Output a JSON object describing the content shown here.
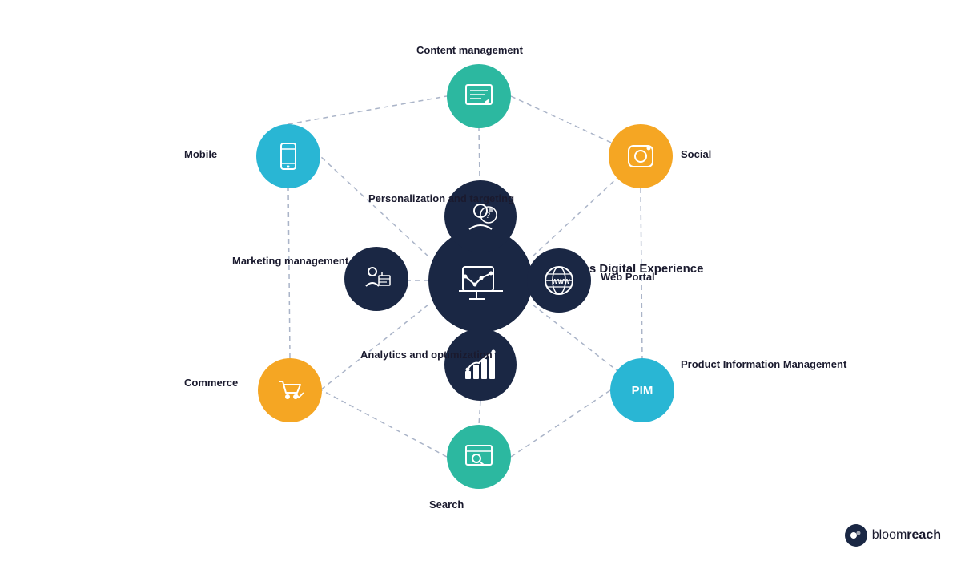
{
  "diagram": {
    "title": "Seamless Digital Experience",
    "nodes": {
      "center": {
        "label": "Seamless Digital\nExperience",
        "icon": "📊",
        "color": "#1a2744"
      },
      "content_management": {
        "label": "Content management",
        "icon": "🖥",
        "color": "#2cb8a0"
      },
      "personalization": {
        "label": "Personalization\nand targeting",
        "icon": "💬",
        "color": "#1a2744"
      },
      "web_portal": {
        "label": "Web Portal",
        "icon": "🌐",
        "color": "#1a2744"
      },
      "analytics": {
        "label": "Analytics and\noptimization",
        "icon": "📈",
        "color": "#1a2744"
      },
      "social": {
        "label": "Social",
        "icon": "📷",
        "color": "#f5a623"
      },
      "mobile": {
        "label": "Mobile",
        "icon": "📱",
        "color": "#29b6d4"
      },
      "marketing": {
        "label": "Marketing\nmanagement",
        "icon": "📋",
        "color": "#1a2744"
      },
      "commerce": {
        "label": "Commerce",
        "icon": "🛒",
        "color": "#f5a623"
      },
      "search": {
        "label": "Search",
        "icon": "🔍",
        "color": "#2cb8a0"
      },
      "pim": {
        "label": "Product\nInformation\nManagement",
        "icon": "PIM",
        "color": "#29b6d4"
      }
    }
  },
  "logo": {
    "text_light": "bloom",
    "text_bold": "reach"
  }
}
